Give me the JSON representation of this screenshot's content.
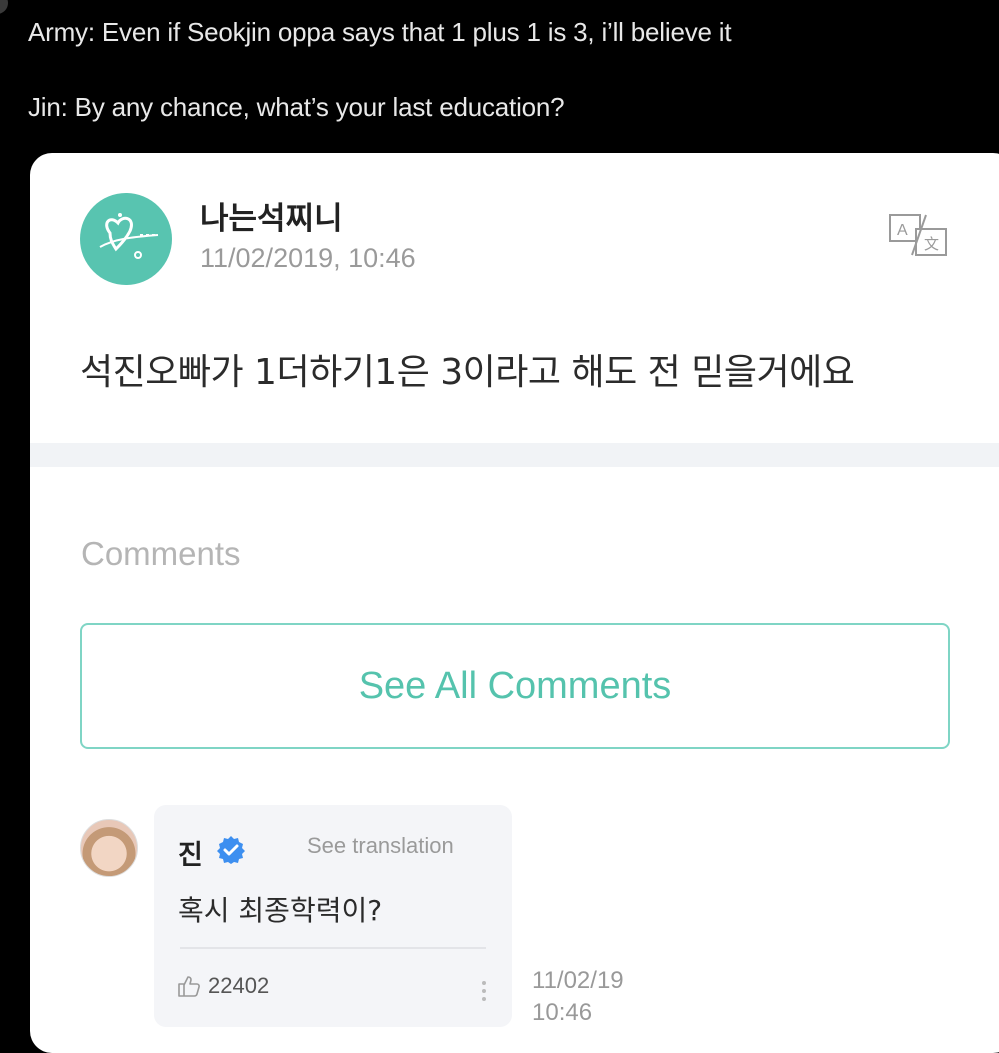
{
  "tweet": {
    "line1": "Army: Even if Seokjin oppa says that 1 plus 1 is 3, i’ll believe it",
    "line2": "Jin: By any chance, what’s your last education?"
  },
  "post": {
    "username": "나는석찌니",
    "timestamp": "11/02/2019, 10:46",
    "text": "석진오빠가 1더하기1은 3이라고 해도 전 믿을거에요",
    "translate_icon": "translate-icon"
  },
  "comments": {
    "section_label": "Comments",
    "see_all_label": "See All Comments",
    "items": [
      {
        "author": "진",
        "verified_icon": "verified-badge-icon",
        "see_translation": "See translation",
        "text": "혹시 최종학력이?",
        "likes": "22402",
        "like_icon": "thumbs-up-icon",
        "more_icon": "more-vertical-icon",
        "date": "11/02/19",
        "time": "10:46"
      }
    ]
  },
  "colors": {
    "accent": "#55c3ad",
    "avatar_bg": "#58c4b0",
    "verified": "#3d8ff0"
  }
}
